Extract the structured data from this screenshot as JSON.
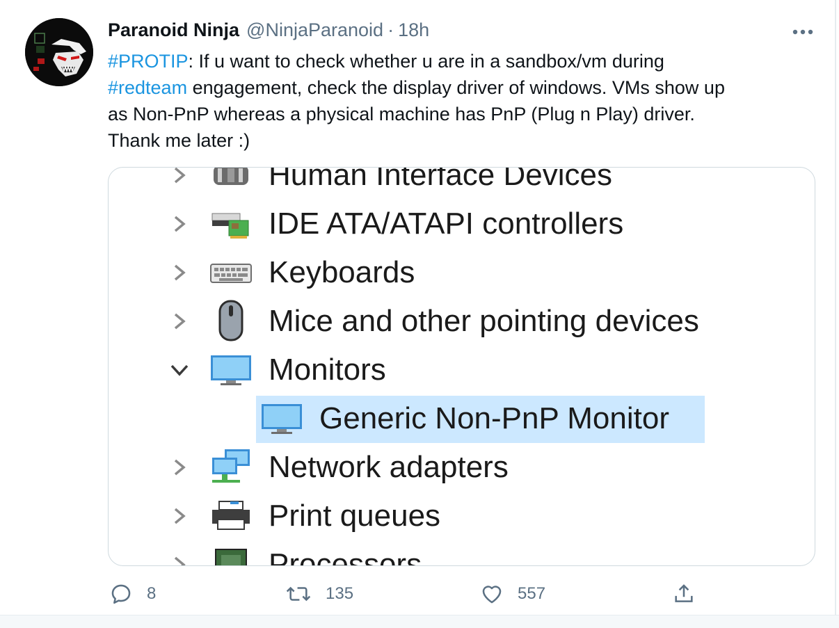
{
  "tweet": {
    "author_name": "Paranoid Ninja",
    "handle": "@NinjaParanoid",
    "separator": "·",
    "time": "18h",
    "text_lines": [
      [
        {
          "t": "#PROTIP",
          "tag": true
        },
        {
          "t": ": If u want to check whether u are in a sandbox/vm during",
          "tag": false
        }
      ],
      [
        {
          "t": "#redteam",
          "tag": true
        },
        {
          "t": " engagement, check the display driver of windows. VMs show up",
          "tag": false
        }
      ],
      [
        {
          "t": "as Non-PnP whereas a physical machine has PnP (Plug n Play) driver.",
          "tag": false
        }
      ],
      [
        {
          "t": "Thank me later :)",
          "tag": false
        }
      ]
    ],
    "hashtag_color": "#1b95e0"
  },
  "device_manager": {
    "items": [
      {
        "label": "Human Interface Devices",
        "icon": "hid-icon",
        "expanded": false
      },
      {
        "label": "IDE ATA/ATAPI controllers",
        "icon": "ide-controller-icon",
        "expanded": false
      },
      {
        "label": "Keyboards",
        "icon": "keyboard-icon",
        "expanded": false
      },
      {
        "label": "Mice and other pointing devices",
        "icon": "mouse-icon",
        "expanded": false
      },
      {
        "label": "Monitors",
        "icon": "monitor-icon",
        "expanded": true
      },
      {
        "label": "Generic Non-PnP Monitor",
        "icon": "monitor-icon",
        "child": true,
        "selected": true
      },
      {
        "label": "Network adapters",
        "icon": "network-adapter-icon",
        "expanded": false
      },
      {
        "label": "Print queues",
        "icon": "printer-icon",
        "expanded": false
      },
      {
        "label": "Processors",
        "icon": "processor-icon",
        "expanded": false
      }
    ],
    "selection_color": "#cce8ff"
  },
  "actions": {
    "replies": "8",
    "retweets": "135",
    "likes": "557"
  }
}
